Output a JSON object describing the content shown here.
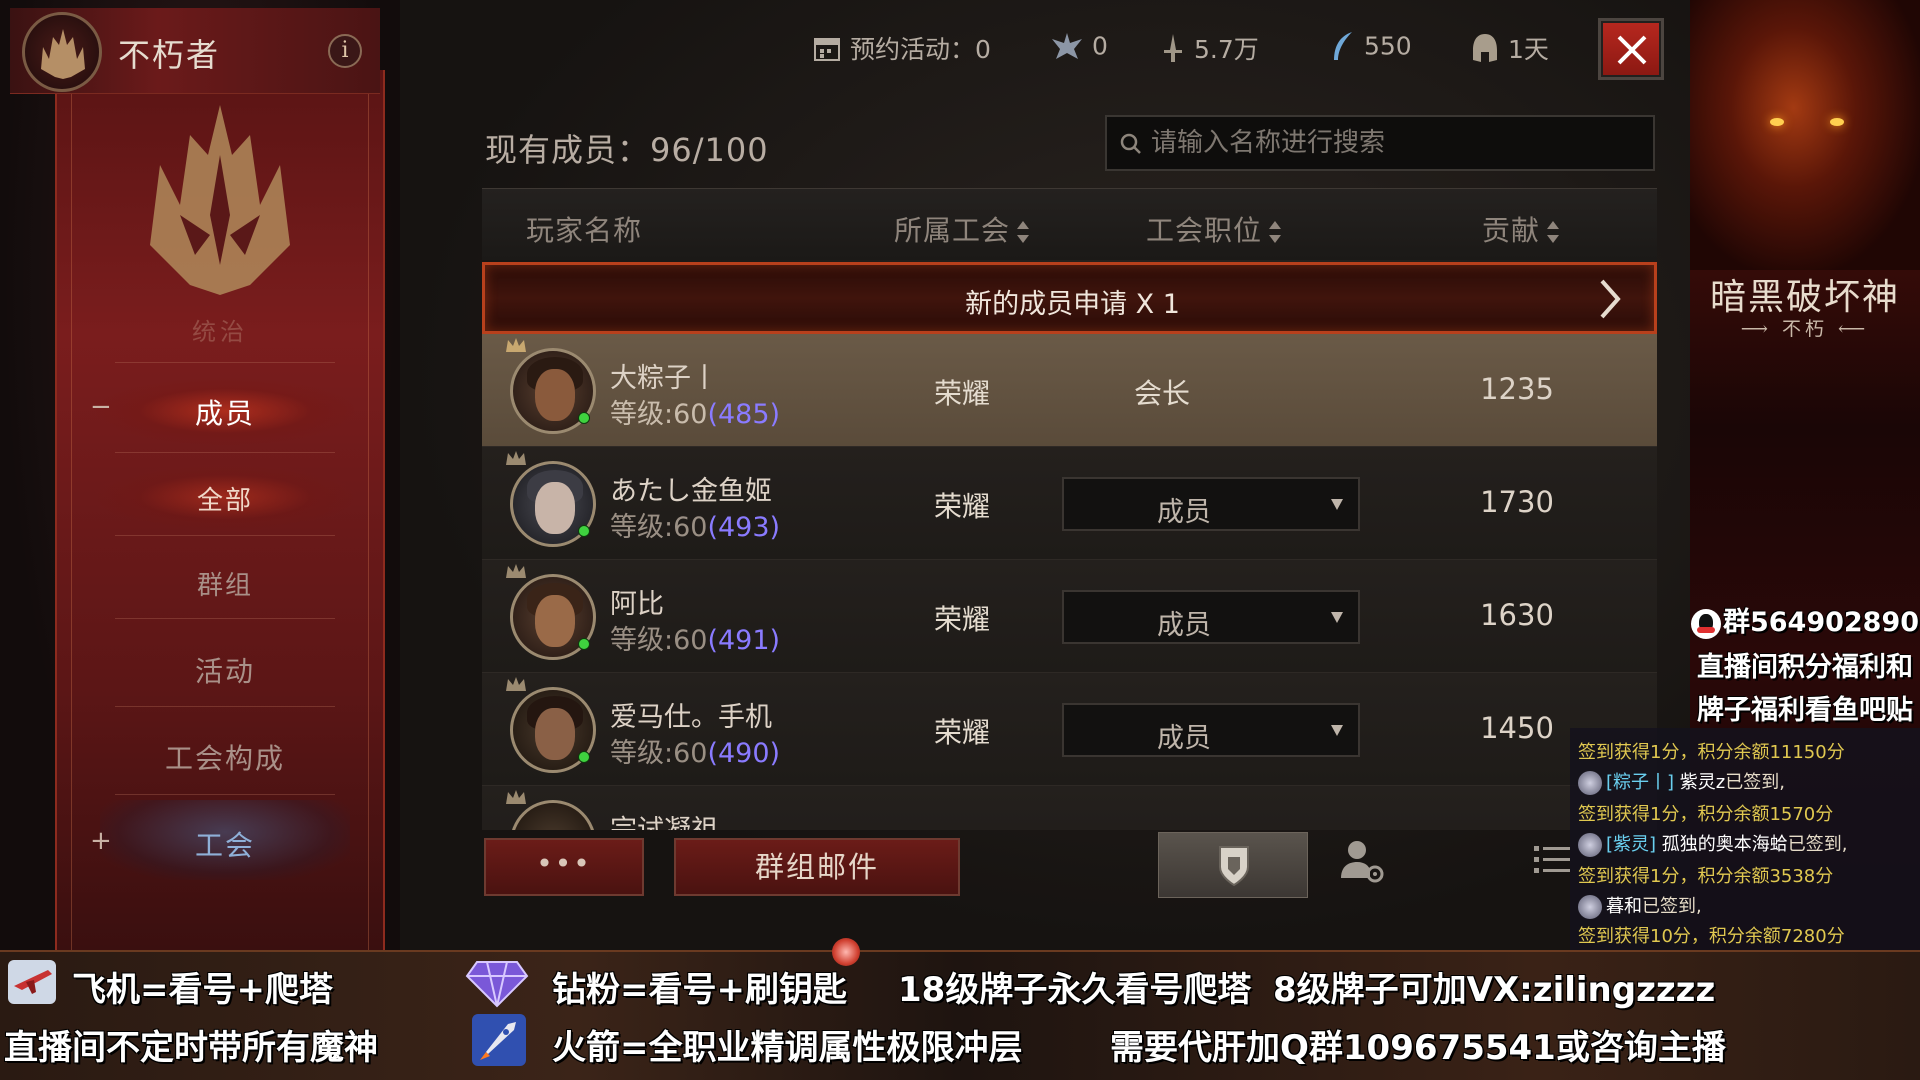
{
  "header": {
    "guild_name": "不朽者",
    "info_label": "i",
    "stats": [
      {
        "icon": "calendar-icon",
        "label": "预约活动：0"
      },
      {
        "icon": "crest-icon",
        "label": "0"
      },
      {
        "icon": "sword-icon",
        "label": "5.7万"
      },
      {
        "icon": "feather-icon",
        "label": "550"
      },
      {
        "icon": "helmet-icon",
        "label": "1天"
      }
    ]
  },
  "sidebar": {
    "faded_label": "统治",
    "items": [
      {
        "label": "成员",
        "expander": "−"
      },
      {
        "label": "全部"
      },
      {
        "label": "群组"
      },
      {
        "label": "活动"
      },
      {
        "label": "工会构成"
      },
      {
        "label": "工会",
        "expander": "+"
      }
    ]
  },
  "members": {
    "count_label": "现有成员：96/100",
    "search_placeholder": "请输入名称进行搜索",
    "columns": [
      "玩家名称",
      "所属工会",
      "工会职位",
      "贡献"
    ],
    "request_banner": "新的成员申请 X 1",
    "rows": [
      {
        "name": "大粽子丨",
        "level": "等级:60",
        "level_extra": "(485)",
        "guild": "荣耀",
        "role": "会长",
        "contribution": "1235",
        "selected": true,
        "skin": "#8a5a3c",
        "hair": "#2a1a12"
      },
      {
        "name": "あたし金鱼姬",
        "level": "等级:60",
        "level_extra": "(493)",
        "guild": "荣耀",
        "role": "成员",
        "contribution": "1730",
        "selected": false,
        "skin": "#c8b4a8",
        "hair": "#3c3c44"
      },
      {
        "name": "阿比",
        "level": "等级:60",
        "level_extra": "(491)",
        "guild": "荣耀",
        "role": "成员",
        "contribution": "1630",
        "selected": false,
        "skin": "#9a6a48",
        "hair": "#3a2418"
      },
      {
        "name": "爱马仕。手机",
        "level": "等级:60",
        "level_extra": "(490)",
        "guild": "荣耀",
        "role": "成员",
        "contribution": "1450",
        "selected": false,
        "skin": "#8a6046",
        "hair": "#241610"
      },
      {
        "name": "宗试凝祖",
        "level": "",
        "level_extra": "",
        "guild": "",
        "role": "",
        "contribution": "",
        "selected": false,
        "skin": "#8a6046",
        "hair": "#241610"
      }
    ],
    "buttons": {
      "more": "•••",
      "group_mail": "群组邮件"
    }
  },
  "stream": {
    "game_title": "暗黑破坏神",
    "game_subtitle": "⟶ 不朽 ⟵",
    "qq_group": "群564902890",
    "promo_line1": "直播间积分福利和",
    "promo_line2": "牌子福利看鱼吧贴",
    "chat": [
      {
        "prefix": "",
        "nick": "",
        "name": "",
        "text": "签到获得1分，积分余额11150分",
        "type": "gain"
      },
      {
        "prefix": "",
        "nick": "[粽子丨]",
        "name": "紫灵z",
        "text": "已签到,",
        "type": "user"
      },
      {
        "prefix": "",
        "nick": "",
        "name": "",
        "text": "签到获得1分，积分余额1570分",
        "type": "gain"
      },
      {
        "prefix": "",
        "nick": "[紫灵]",
        "name": "孤独的奥本海蛤",
        "text": "已签到,",
        "type": "user"
      },
      {
        "prefix": "",
        "nick": "",
        "name": "",
        "text": "签到获得1分，积分余额3538分",
        "type": "gain"
      },
      {
        "prefix": "",
        "nick": "",
        "name": "暮和",
        "text": "已签到,",
        "type": "user"
      },
      {
        "prefix": "",
        "nick": "",
        "name": "",
        "text": "签到获得10分，积分余额7280分",
        "type": "gain"
      }
    ],
    "overlay": {
      "plane": "飞机=看号+爬塔",
      "diamond": "钻粉=看号+刷钥匙",
      "badge18": "18级牌子永久看号爬塔",
      "badge8": "8级牌子可加VX:zilingzzzz",
      "demon_gods": "直播间不定时带所有魔神",
      "rocket": "火箭=全职业精调属性极限冲层",
      "service": "需要代肝加Q群109675541或咨询主播"
    }
  },
  "colors": {
    "accent_red": "#b8281f",
    "level_purple": "#8a7bff",
    "online_green": "#3fd23f",
    "request_border": "#b8401c"
  }
}
